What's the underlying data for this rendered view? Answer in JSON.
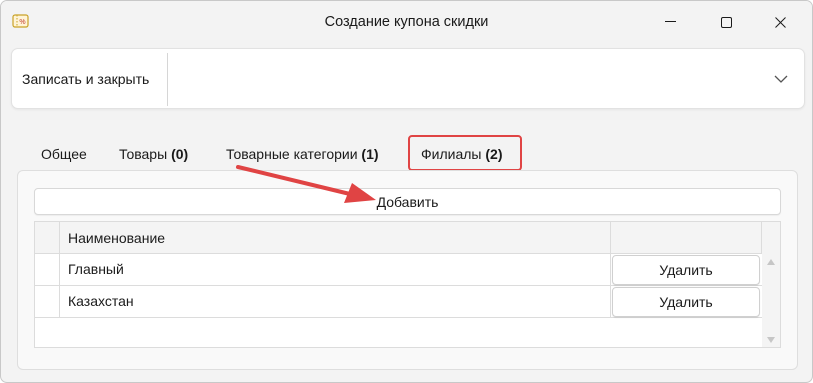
{
  "window": {
    "title": "Создание купона скидки",
    "icon": "coupon-icon"
  },
  "toolbar": {
    "save_close_label": "Записать и закрыть"
  },
  "tabs": [
    {
      "label": "Общее",
      "count": ""
    },
    {
      "label": "Товары",
      "count": "(0)"
    },
    {
      "label": "Товарные категории",
      "count": "(1)"
    },
    {
      "label": "Филиалы",
      "count": "(2)"
    }
  ],
  "branches": {
    "add_label": "Добавить",
    "columns": [
      "Наименование"
    ],
    "rows": [
      {
        "name": "Главный",
        "action": "Удалить"
      },
      {
        "name": "Казахстан",
        "action": "Удалить"
      }
    ]
  },
  "colors": {
    "highlight": "#e04444",
    "window_bg": "#f3f3f3"
  }
}
